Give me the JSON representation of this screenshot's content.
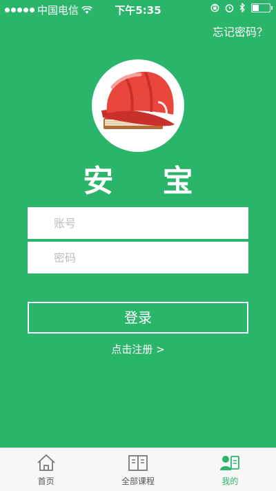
{
  "status_bar": {
    "carrier": "中国电信",
    "time": "下午5:35"
  },
  "header": {
    "forgot_password": "忘记密码？"
  },
  "brand": {
    "name": "安 宝"
  },
  "form": {
    "account_placeholder": "账号",
    "password_placeholder": "密码",
    "login_label": "登录",
    "register_label": "点击注册 >"
  },
  "tabs": [
    {
      "label": "首页",
      "icon": "home-icon",
      "active": false
    },
    {
      "label": "全部课程",
      "icon": "book-icon",
      "active": false
    },
    {
      "label": "我的",
      "icon": "profile-icon",
      "active": true
    }
  ],
  "colors": {
    "background": "#2bb56a",
    "accent": "#2bb56a",
    "tab_bar": "#f7f7f7",
    "helmet": "#e8453c"
  }
}
